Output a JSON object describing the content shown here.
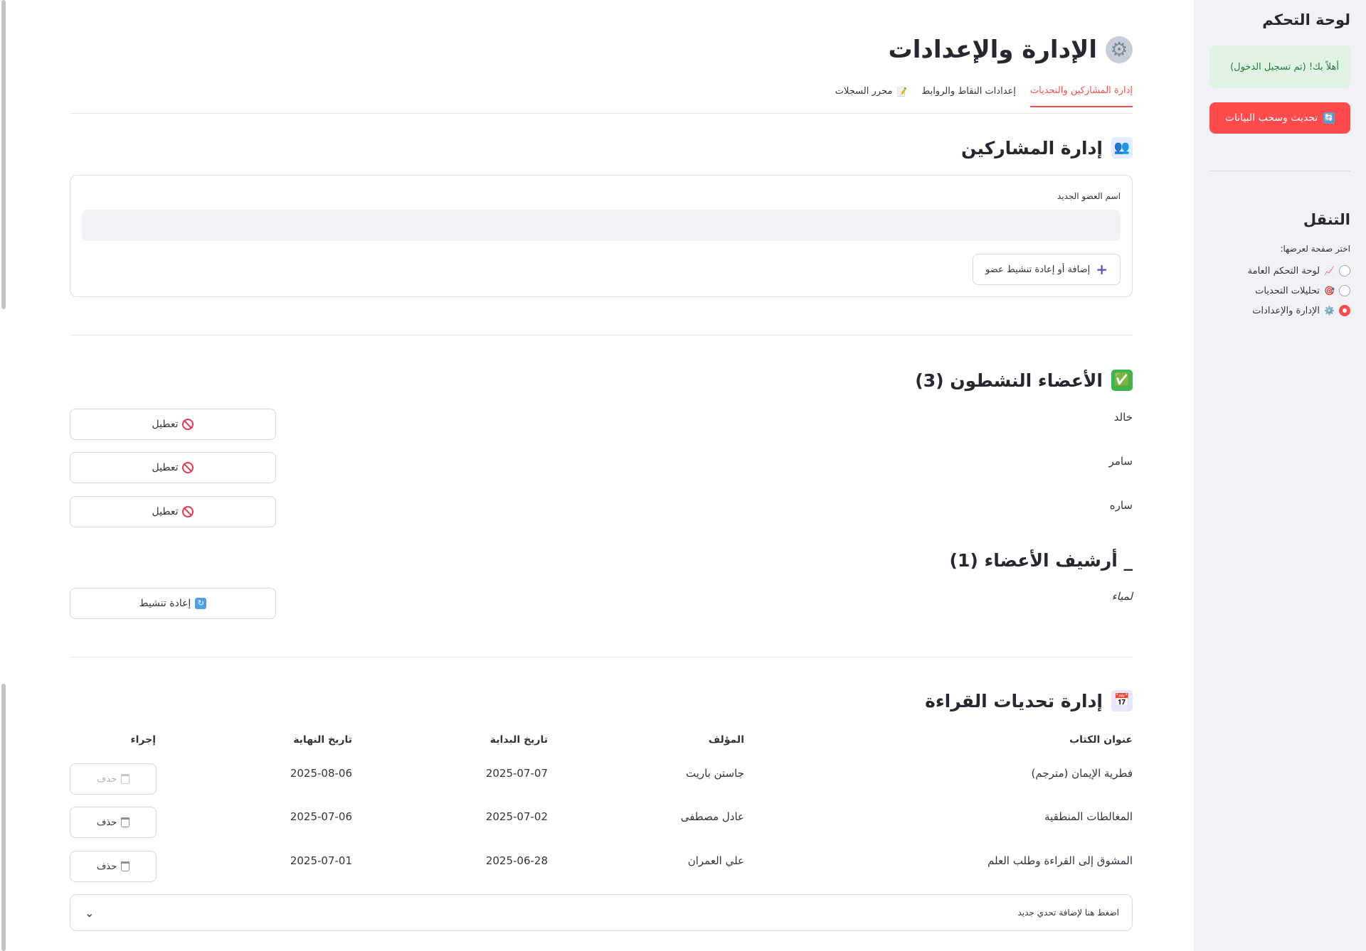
{
  "sidebar": {
    "title": "لوحة التحكم",
    "welcome": "أهلاً بك! (تم تسجيل الدخول)",
    "refresh_button": "تحديث وسحب البيانات",
    "refresh_icon": "🔄",
    "nav_title": "التنقل",
    "nav_prompt": "اختر صفحة لعرضها:",
    "nav_items": [
      {
        "emoji": "📈",
        "label": "لوحة التحكم العامة",
        "selected": false
      },
      {
        "emoji": "🎯",
        "label": "تحليلات التحديات",
        "selected": false
      },
      {
        "emoji": "⚙️",
        "label": "الإدارة والإعدادات",
        "selected": true
      }
    ],
    "accent": "#ff4b4b"
  },
  "page": {
    "title": "الإدارة والإعدادات",
    "title_icon": "⚙"
  },
  "tabs": [
    {
      "label": "إدارة المشاركين والتحديات",
      "active": true,
      "icon": ""
    },
    {
      "label": "إعدادات النقاط والروابط",
      "active": false,
      "icon": ""
    },
    {
      "label": "محرر السجلات",
      "active": false,
      "icon": "📝"
    }
  ],
  "participants": {
    "heading": "إدارة المشاركين",
    "heading_icon": "👥",
    "new_member_label": "اسم العضو الجديد",
    "new_member_value": "",
    "add_button": "إضافة أو إعادة تنشيط عضو",
    "add_icon": "+"
  },
  "active_members": {
    "heading": "الأعضاء النشطون (3)",
    "heading_icon": "✅",
    "deactivate_label": "تعطيل",
    "members": [
      "خالد",
      "سامر",
      "ساره"
    ]
  },
  "archive": {
    "heading": "_ أرشيف الأعضاء (1)",
    "reactivate_label": "إعادة تنشيط",
    "members": [
      "لمياء"
    ]
  },
  "challenges": {
    "heading": "إدارة تحديات القراءة",
    "heading_icon": "📅",
    "columns": {
      "title": "عنوان الكتاب",
      "author": "المؤلف",
      "start": "تاريخ البداية",
      "end": "تاريخ النهاية",
      "action": "إجراء"
    },
    "delete_label": "حذف",
    "rows": [
      {
        "title": "فطرية الإيمان (مترجم)",
        "author": "جاستن باريت",
        "start": "2025-07-07",
        "end": "2025-08-06",
        "delete_disabled": true
      },
      {
        "title": "المغالطات المنطقية",
        "author": "عادل مصطفى",
        "start": "2025-07-02",
        "end": "2025-07-06",
        "delete_disabled": false
      },
      {
        "title": "المشوق إلى القراءة وطلب العلم",
        "author": "علي العمران",
        "start": "2025-06-28",
        "end": "2025-07-01",
        "delete_disabled": false
      }
    ],
    "add_expander": "اضغط هنا لإضافة تحدي جديد"
  }
}
